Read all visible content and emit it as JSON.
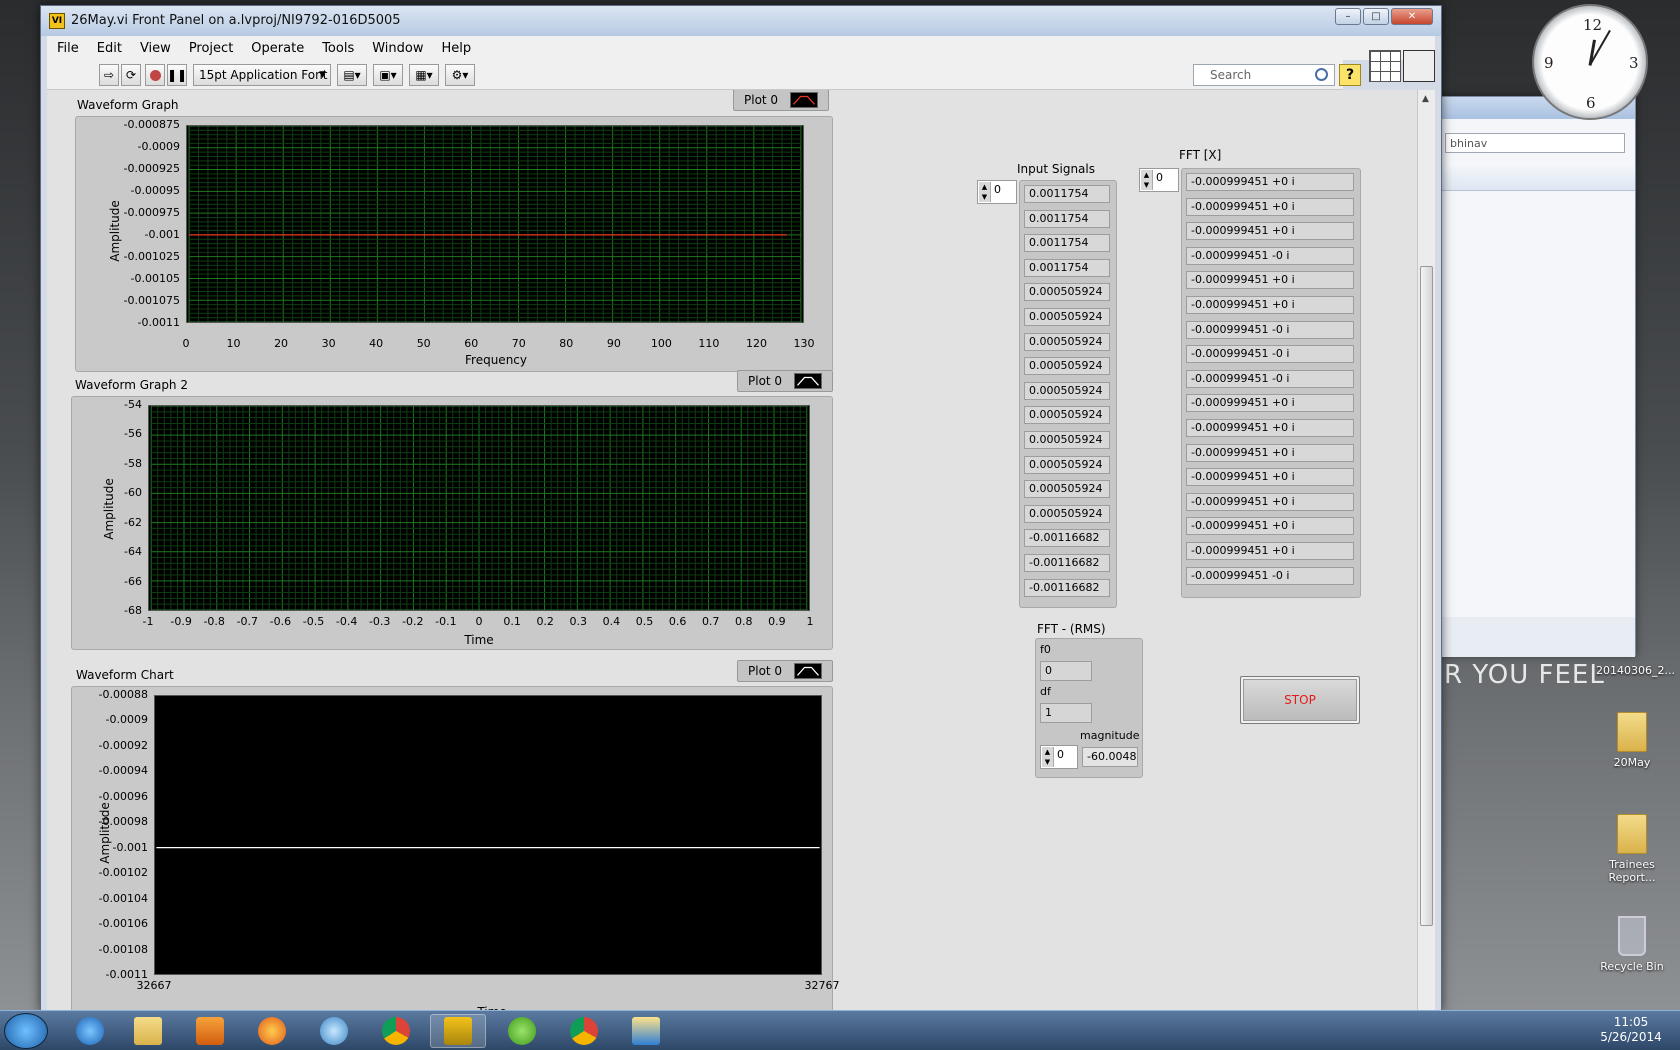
{
  "window": {
    "title": "26May.vi Front Panel on a.lvproj/NI9792-016D5005",
    "icon_text": "VI"
  },
  "menu": [
    "File",
    "Edit",
    "View",
    "Project",
    "Operate",
    "Tools",
    "Window",
    "Help"
  ],
  "toolbar": {
    "font_label": "15pt Application Font",
    "search_placeholder": "Search",
    "help_label": "?"
  },
  "graph1": {
    "label": "Waveform Graph",
    "legend": "Plot 0",
    "ylabel": "Amplitude",
    "xlabel": "Frequency",
    "yticks": [
      "-0.000875",
      "-0.0009",
      "-0.000925",
      "-0.00095",
      "-0.000975",
      "-0.001",
      "-0.001025",
      "-0.00105",
      "-0.001075",
      "-0.0011"
    ],
    "xticks": [
      "0",
      "10",
      "20",
      "30",
      "40",
      "50",
      "60",
      "70",
      "80",
      "90",
      "100",
      "110",
      "120",
      "130"
    ]
  },
  "graph2": {
    "label": "Waveform Graph 2",
    "legend": "Plot 0",
    "ylabel": "Amplitude",
    "xlabel": "Time",
    "yticks": [
      "-54",
      "-56",
      "-58",
      "-60",
      "-62",
      "-64",
      "-66",
      "-68"
    ],
    "xticks": [
      "-1",
      "-0.9",
      "-0.8",
      "-0.7",
      "-0.6",
      "-0.5",
      "-0.4",
      "-0.3",
      "-0.2",
      "-0.1",
      "0",
      "0.1",
      "0.2",
      "0.3",
      "0.4",
      "0.5",
      "0.6",
      "0.7",
      "0.8",
      "0.9",
      "1"
    ]
  },
  "chart": {
    "label": "Waveform Chart",
    "legend": "Plot 0",
    "ylabel": "Amplitude",
    "xlabel": "Time",
    "yticks": [
      "-0.00088",
      "-0.0009",
      "-0.00092",
      "-0.00094",
      "-0.00096",
      "-0.00098",
      "-0.001",
      "-0.00102",
      "-0.00104",
      "-0.00106",
      "-0.00108",
      "-0.0011"
    ],
    "xmin": "32667",
    "xmax": "32767"
  },
  "chart_data": [
    {
      "type": "line",
      "title": "Waveform Graph",
      "xlabel": "Frequency",
      "ylabel": "Amplitude",
      "xlim": [
        0,
        130
      ],
      "ylim": [
        -0.0011,
        -0.000875
      ],
      "series": [
        {
          "name": "Plot 0",
          "color": "#e8351f",
          "x": [
            0,
            127
          ],
          "y": [
            -0.001,
            -0.001
          ]
        }
      ],
      "grid": true
    },
    {
      "type": "line",
      "title": "Waveform Graph 2",
      "xlabel": "Time",
      "ylabel": "Amplitude",
      "xlim": [
        -1,
        1
      ],
      "ylim": [
        -68,
        -54
      ],
      "series": [
        {
          "name": "Plot 0",
          "x": [],
          "y": []
        }
      ],
      "grid": true
    },
    {
      "type": "line",
      "title": "Waveform Chart",
      "xlabel": "Time",
      "ylabel": "Amplitude",
      "xlim": [
        32667,
        32767
      ],
      "ylim": [
        -0.0011,
        -0.00088
      ],
      "series": [
        {
          "name": "Plot 0",
          "color": "#ffffff",
          "x": [
            32667,
            32767
          ],
          "y": [
            -0.001,
            -0.001
          ]
        }
      ],
      "grid": false
    }
  ],
  "input_signals": {
    "label": "Input Signals",
    "index": "0",
    "values": [
      "0.0011754",
      "0.0011754",
      "0.0011754",
      "0.0011754",
      "0.000505924",
      "0.000505924",
      "0.000505924",
      "0.000505924",
      "0.000505924",
      "0.000505924",
      "0.000505924",
      "0.000505924",
      "0.000505924",
      "0.000505924",
      "-0.00116682",
      "-0.00116682",
      "-0.00116682"
    ]
  },
  "fft_x": {
    "label": "FFT [X]",
    "index": "0",
    "values": [
      "-0.000999451 +0 i",
      "-0.000999451 +0 i",
      "-0.000999451 +0 i",
      "-0.000999451 -0 i",
      "-0.000999451 +0 i",
      "-0.000999451 +0 i",
      "-0.000999451 -0 i",
      "-0.000999451 -0 i",
      "-0.000999451 -0 i",
      "-0.000999451 +0 i",
      "-0.000999451 +0 i",
      "-0.000999451 +0 i",
      "-0.000999451 +0 i",
      "-0.000999451 +0 i",
      "-0.000999451 +0 i",
      "-0.000999451 +0 i",
      "-0.000999451 -0 i"
    ]
  },
  "fft_rms": {
    "label": "FFT - (RMS)",
    "f0_label": "f0",
    "f0": "0",
    "df_label": "df",
    "df": "1",
    "magnitude_label": "magnitude",
    "magnitude_index": "0",
    "magnitude": "-60.0048"
  },
  "stop_label": "STOP",
  "desktop": {
    "side_window_search": "bhinav",
    "wall_text": "R YOU FEEL",
    "file_label": "20140306_2...",
    "icons": [
      {
        "label": "20May"
      },
      {
        "label": "Trainees Report..."
      },
      {
        "label": "Recycle Bin"
      }
    ]
  },
  "taskbar": {
    "time": "11:05",
    "date": "5/26/2014"
  }
}
